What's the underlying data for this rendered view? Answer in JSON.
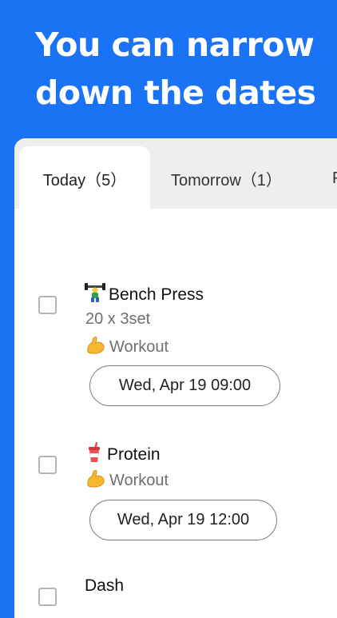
{
  "headline": {
    "line1": "You can narrow",
    "line2": "down the dates"
  },
  "tabs": [
    {
      "label": "Today（5）",
      "selected": true
    },
    {
      "label": "Tomorrow（1）",
      "selected": false
    },
    {
      "label": "P",
      "selected": false
    }
  ],
  "tasks": [
    {
      "icon": "weightlifting-emoji",
      "title": "Bench Press",
      "detail": "20 x 3set",
      "category_icon": "flexed-biceps-emoji",
      "category": "Workout",
      "date": "Wed, Apr 19 09:00",
      "checked": false
    },
    {
      "icon": "cup-with-straw-emoji",
      "title": "Protein",
      "category_icon": "flexed-biceps-emoji",
      "category": "Workout",
      "date": "Wed, Apr 19 12:00",
      "checked": false
    },
    {
      "title": "Dash",
      "checked": false
    }
  ],
  "colors": {
    "background": "#1a73f5",
    "card": "#ffffff",
    "tabbar": "#eeeeee"
  }
}
